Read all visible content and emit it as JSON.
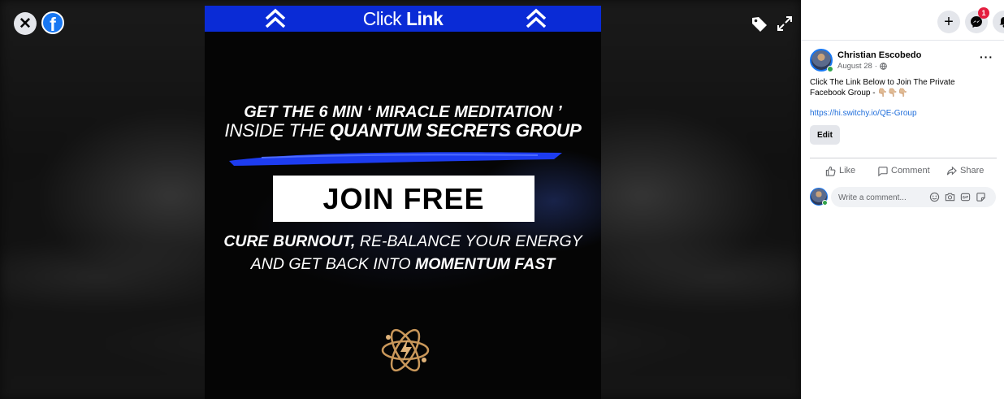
{
  "viewer": {
    "close_glyph": "✕",
    "brand_glyph": "f",
    "icons": [
      "close-icon",
      "facebook-logo-icon",
      "tag-icon",
      "expand-icon"
    ]
  },
  "graphic": {
    "click_word": "Click",
    "link_word": "Link",
    "line1": "GET THE 6 MIN  ‘ MIRACLE MEDITATION ’",
    "line2_prefix": "INSIDE THE ",
    "line2_bold": "QUANTUM SECRETS GROUP",
    "cta": "JOIN FREE",
    "line3_bold": "CURE BURNOUT,",
    "line3_rest": " RE-BALANCE YOUR ENERGY",
    "line4_prefix": "AND GET BACK INTO ",
    "line4_bold": "MOMENTUM FAST",
    "colors": {
      "bar": "#0a2bd6",
      "stroke": "#1d3cf0"
    }
  },
  "topbar": {
    "plus_glyph": "+",
    "notification_count": "1",
    "icons": [
      "plus-icon",
      "messenger-icon",
      "bell-icon"
    ]
  },
  "post": {
    "author": "Christian Escobedo",
    "date": "August 28",
    "separator": "·",
    "more_glyph": "···",
    "text": "Click The Link Below to Join The Private Facebook Group - 👇🏼👇🏼👇🏼",
    "link": "https://hi.switchy.io/QE-Group",
    "edit_label": "Edit",
    "actions": {
      "like": "Like",
      "comment": "Comment",
      "share": "Share"
    },
    "comment_placeholder": "Write a comment..."
  },
  "colors": {
    "facebook_blue": "#1877f2",
    "link": "#216fdb",
    "badge": "#e41e3f",
    "online": "#31a24c"
  }
}
